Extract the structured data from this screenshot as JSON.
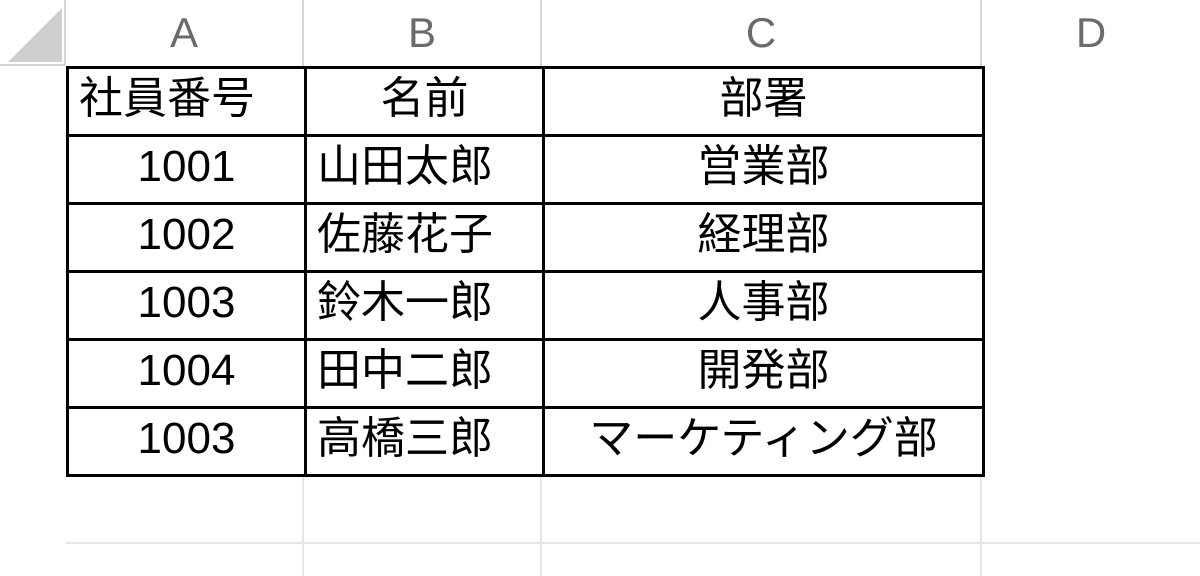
{
  "columns": {
    "A": "A",
    "B": "B",
    "C": "C",
    "D": "D"
  },
  "headers": {
    "id": "社員番号",
    "name": "名前",
    "dept": "部署"
  },
  "rows": [
    {
      "id": "1001",
      "name": "山田太郎",
      "dept": "営業部"
    },
    {
      "id": "1002",
      "name": "佐藤花子",
      "dept": "経理部"
    },
    {
      "id": "1003",
      "name": "鈴木一郎",
      "dept": "人事部"
    },
    {
      "id": "1004",
      "name": "田中二郎",
      "dept": "開発部"
    },
    {
      "id": "1003",
      "name": "高橋三郎",
      "dept": "マーケティング部"
    }
  ],
  "chart_data": {
    "type": "table",
    "columns": [
      "社員番号",
      "名前",
      "部署"
    ],
    "rows": [
      [
        "1001",
        "山田太郎",
        "営業部"
      ],
      [
        "1002",
        "佐藤花子",
        "経理部"
      ],
      [
        "1003",
        "鈴木一郎",
        "人事部"
      ],
      [
        "1004",
        "田中二郎",
        "開発部"
      ],
      [
        "1003",
        "高橋三郎",
        "マーケティング部"
      ]
    ]
  }
}
